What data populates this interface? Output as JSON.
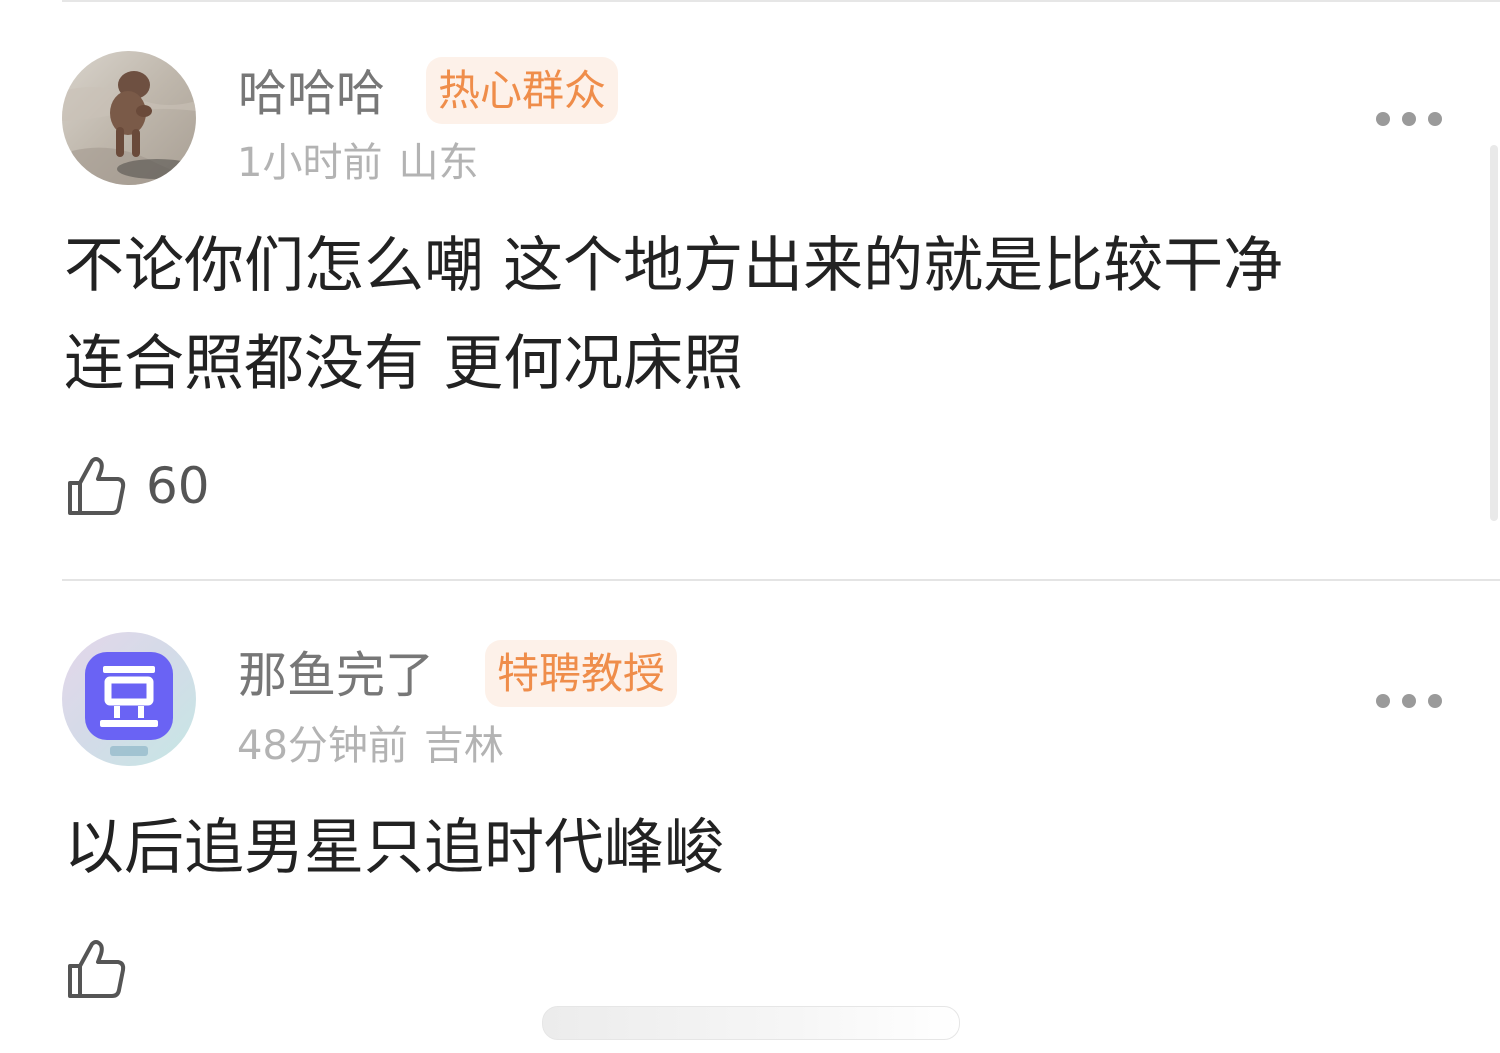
{
  "comments": [
    {
      "username": "哈哈哈",
      "badge": "热心群众",
      "time": "1小时前",
      "location": "山东",
      "text_lines": [
        "不论你们怎么嘲 这个地方出来的就是比较干净",
        "连合照都没有 更何况床照"
      ],
      "like_count": "60",
      "avatar": "dog-photo-avatar"
    },
    {
      "username": "那鱼完了",
      "badge": "特聘教授",
      "time": "48分钟前",
      "location": "吉林",
      "text_lines": [
        "以后追男星只追时代峰峻"
      ],
      "like_count": "",
      "avatar": "douban-app-avatar"
    }
  ],
  "colors": {
    "badge_text": "#ef8d4a",
    "badge_bg": "#fdf1e9",
    "username": "#777777",
    "meta": "#b3b3b3",
    "body": "#222222"
  },
  "icons": {
    "more": "more-dots-icon",
    "like": "thumbs-up-icon"
  }
}
